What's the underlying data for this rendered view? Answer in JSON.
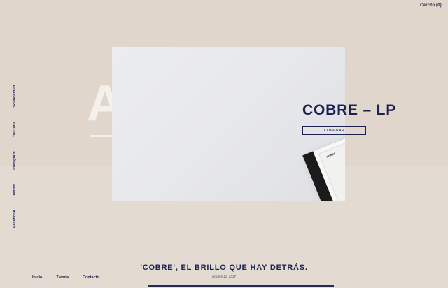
{
  "header": {
    "cart_label": "Carrito (0)"
  },
  "hero": {
    "background_letter": "A",
    "title": "COBRE – LP",
    "buy_label": "COMPRAR",
    "cd": {
      "cover_title": "COBRE"
    }
  },
  "social": {
    "items": [
      "Facebook",
      "Twitter",
      "Instagram",
      "YouTube",
      "Soundcloud"
    ]
  },
  "nav": {
    "items": [
      "Inicio",
      "Tienda",
      "Contacto"
    ]
  },
  "post": {
    "title": "'COBRE', EL BRILLO QUE HAY DETRÁS.",
    "date": "octubre 12, 2017"
  },
  "colors": {
    "accent": "#1c2150",
    "background": "#e2d9cf",
    "photo": "#e8e9eb"
  }
}
